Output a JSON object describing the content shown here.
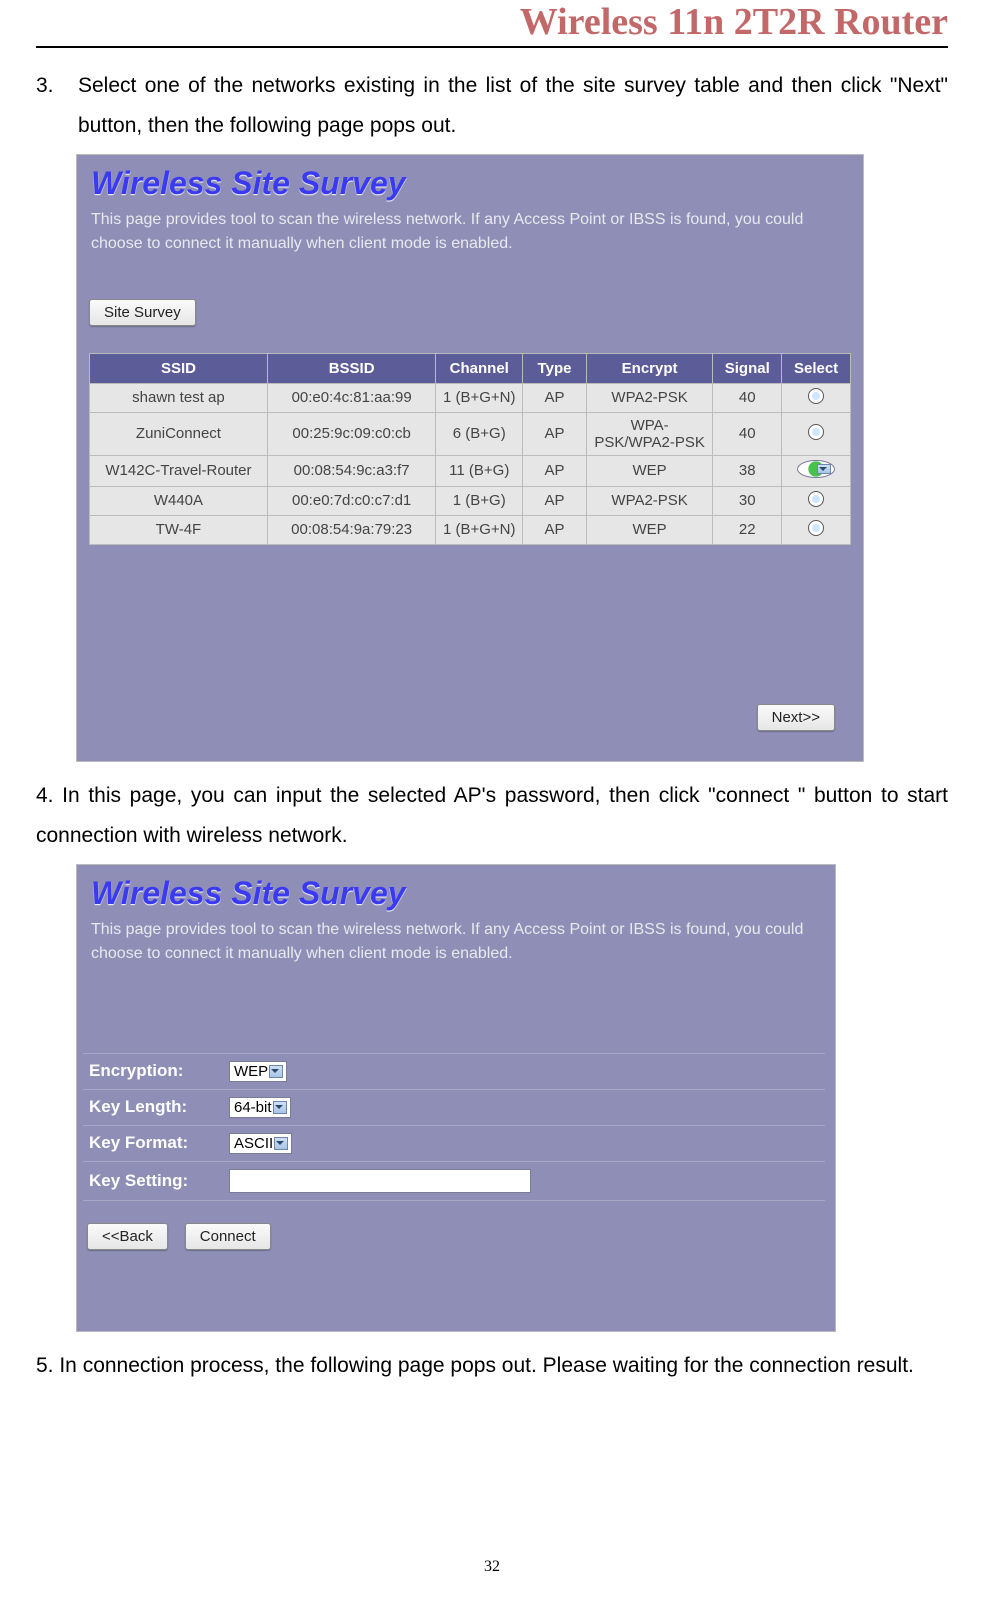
{
  "header": {
    "title": "Wireless 11n 2T2R Router"
  },
  "step3": {
    "num": "3.",
    "text": "Select one of the networks existing in the list of the site survey table and then click \"Next\" button, then the following page pops out."
  },
  "shot1": {
    "title": "Wireless Site Survey",
    "desc": "This page provides tool to scan the wireless network. If any Access Point or IBSS is found, you could choose to connect it manually when client mode is enabled.",
    "siteSurvey": "Site Survey",
    "cols": {
      "ssid": "SSID",
      "bssid": "BSSID",
      "channel": "Channel",
      "type": "Type",
      "encrypt": "Encrypt",
      "signal": "Signal",
      "select": "Select"
    },
    "rows": [
      {
        "ssid": "shawn test ap",
        "bssid": "00:e0:4c:81:aa:99",
        "channel": "1 (B+G+N)",
        "type": "AP",
        "encrypt": "WPA2-PSK",
        "signal": "40",
        "selected": false
      },
      {
        "ssid": "ZuniConnect",
        "bssid": "00:25:9c:09:c0:cb",
        "channel": "6 (B+G)",
        "type": "AP",
        "encrypt": "WPA-PSK/WPA2-PSK",
        "signal": "40",
        "selected": false
      },
      {
        "ssid": "W142C-Travel-Router",
        "bssid": "00:08:54:9c:a3:f7",
        "channel": "11 (B+G)",
        "type": "AP",
        "encrypt": "WEP",
        "signal": "38",
        "selected": true
      },
      {
        "ssid": "W440A",
        "bssid": "00:e0:7d:c0:c7:d1",
        "channel": "1 (B+G)",
        "type": "AP",
        "encrypt": "WPA2-PSK",
        "signal": "30",
        "selected": false
      },
      {
        "ssid": "TW-4F",
        "bssid": "00:08:54:9a:79:23",
        "channel": "1 (B+G+N)",
        "type": "AP",
        "encrypt": "WEP",
        "signal": "22",
        "selected": false
      }
    ],
    "next": "Next>>"
  },
  "step4": {
    "text": "4. In this page, you can input the selected AP's password, then click \"connect \" button to start connection with wireless network."
  },
  "shot2": {
    "title": "Wireless Site Survey",
    "desc": "This page provides tool to scan the wireless network. If any Access Point or IBSS is found, you could choose to connect it manually when client mode is enabled.",
    "labels": {
      "encryption": "Encryption:",
      "keyLength": "Key Length:",
      "keyFormat": "Key Format:",
      "keySetting": "Key Setting:"
    },
    "values": {
      "encryption": "WEP",
      "keyLength": "64-bit",
      "keyFormat": "ASCII",
      "keySetting": ""
    },
    "back": "<<Back",
    "connect": "Connect"
  },
  "step5": {
    "text": "5. In connection process, the following page pops out. Please waiting for the connection result."
  },
  "pageNumber": "32"
}
